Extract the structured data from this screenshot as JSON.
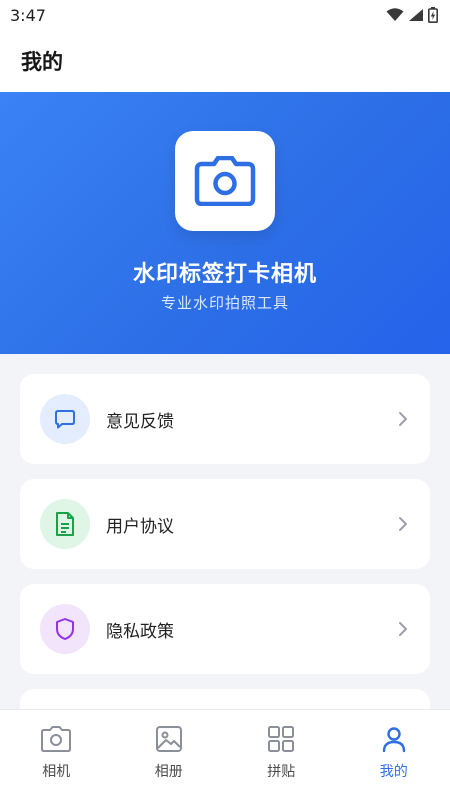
{
  "status_bar": {
    "time": "3:47"
  },
  "header": {
    "title": "我的"
  },
  "hero": {
    "app_name": "水印标签打卡相机",
    "tagline": "专业水印拍照工具",
    "logo_icon": "camera-icon",
    "gradient_start": "#3b82f6",
    "gradient_end": "#2563eb"
  },
  "menu": {
    "items": [
      {
        "label": "意见反馈",
        "icon": "message-icon",
        "icon_color": "#2f6fe4",
        "icon_bg": "#e3edfd"
      },
      {
        "label": "用户协议",
        "icon": "document-icon",
        "icon_color": "#16a34a",
        "icon_bg": "#dff5e6"
      },
      {
        "label": "隐私政策",
        "icon": "shield-icon",
        "icon_color": "#9333ea",
        "icon_bg": "#f1e4fb"
      }
    ]
  },
  "bottom_nav": {
    "items": [
      {
        "label": "相机",
        "icon": "camera-icon",
        "active": false
      },
      {
        "label": "相册",
        "icon": "image-icon",
        "active": false
      },
      {
        "label": "拼贴",
        "icon": "grid-icon",
        "active": false
      },
      {
        "label": "我的",
        "icon": "user-icon",
        "active": true
      }
    ],
    "active_color": "#2f6fe4",
    "inactive_color": "#8a8f98"
  }
}
